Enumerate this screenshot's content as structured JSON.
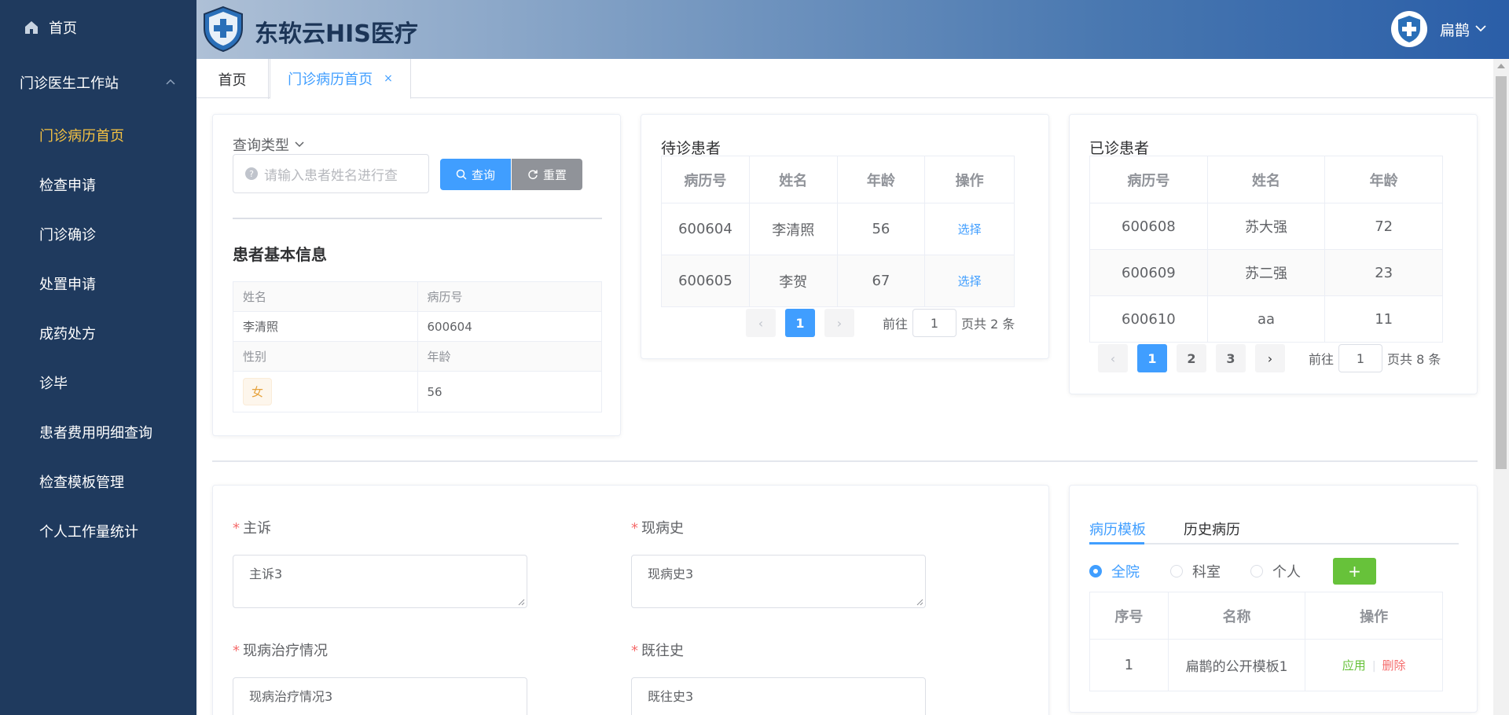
{
  "sidebar": {
    "home_label": "首页",
    "group_label": "门诊医生工作站",
    "items": [
      {
        "label": "门诊病历首页",
        "active": true
      },
      {
        "label": "检查申请"
      },
      {
        "label": "门诊确诊"
      },
      {
        "label": "处置申请"
      },
      {
        "label": "成药处方"
      },
      {
        "label": "诊毕"
      },
      {
        "label": "患者费用明细查询"
      },
      {
        "label": "检查模板管理"
      },
      {
        "label": "个人工作量统计"
      }
    ]
  },
  "header": {
    "brand": "东软云HIS医疗",
    "user": "扁鹊"
  },
  "tabs": {
    "home": "首页",
    "active": "门诊病历首页",
    "close": "×"
  },
  "search": {
    "type_label": "查询类型",
    "placeholder": "请输入患者姓名进行查",
    "query_btn": "查询",
    "reset_btn": "重置"
  },
  "patient_info": {
    "title": "患者基本信息",
    "name_label": "姓名",
    "record_label": "病历号",
    "name": "李清照",
    "record": "600604",
    "gender_label": "性别",
    "age_label": "年龄",
    "gender": "女",
    "age": "56"
  },
  "waiting": {
    "title": "待诊患者",
    "columns": [
      "病历号",
      "姓名",
      "年龄",
      "操作"
    ],
    "rows": [
      {
        "id": "600604",
        "name": "李清照",
        "age": "56",
        "op": "选择"
      },
      {
        "id": "600605",
        "name": "李贺",
        "age": "67",
        "op": "选择"
      }
    ],
    "pager": {
      "current": "1",
      "goto_pre": "前往",
      "goto_val": "1",
      "goto_post": "页共 2 条"
    }
  },
  "done": {
    "title": "已诊患者",
    "columns": [
      "病历号",
      "姓名",
      "年龄"
    ],
    "rows": [
      {
        "id": "600608",
        "name": "苏大强",
        "age": "72"
      },
      {
        "id": "600609",
        "name": "苏二强",
        "age": "23"
      },
      {
        "id": "600610",
        "name": "aa",
        "age": "11"
      }
    ],
    "pager": {
      "pages": [
        "1",
        "2",
        "3"
      ],
      "goto_pre": "前往",
      "goto_val": "1",
      "goto_post": "页共 8 条"
    }
  },
  "form": {
    "chief_label": "主诉",
    "chief_value": "主诉3",
    "present_label": "现病史",
    "present_value": "现病史3",
    "treatment_label": "现病治疗情况",
    "treatment_value": "现病治疗情况3",
    "past_label": "既往史",
    "past_value": "既往史3"
  },
  "templates": {
    "tab_templates": "病历模板",
    "tab_history": "历史病历",
    "radios": [
      "全院",
      "科室",
      "个人"
    ],
    "add_btn": "+",
    "columns": [
      "序号",
      "名称",
      "操作"
    ],
    "rows": [
      {
        "no": "1",
        "name": "扁鹊的公开模板1",
        "apply": "应用",
        "delete": "删除"
      }
    ]
  },
  "colors": {
    "sidebar": "#1f3a5e",
    "active": "#f5c242",
    "primary": "#409eff",
    "success": "#67c23a",
    "danger": "#f56c6c"
  }
}
